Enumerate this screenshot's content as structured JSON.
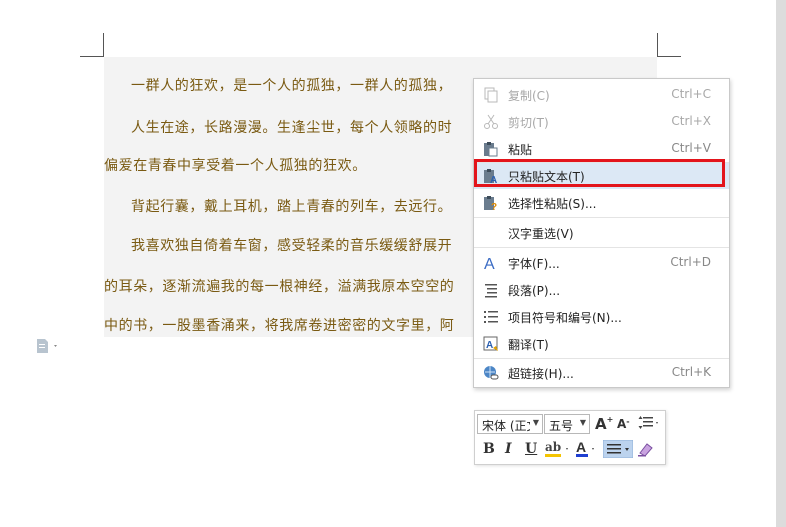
{
  "document": {
    "paragraphs": [
      "一群人的狂欢，是一个人的孤独，一群人的孤独，",
      "人生在途，长路漫漫。生逢尘世，每个人领略的时",
      "偏爱在青春中享受着一个人孤独的狂欢。",
      "背起行囊，戴上耳机，踏上青春的列车，去远行。",
      "我喜欢独自倚着车窗，感受轻柔的音乐缓缓舒展开",
      "的耳朵，逐渐流遍我的每一根神经，溢满我原本空空的",
      "中的书，一股墨香涌来，将我席卷进密密的文字里，阿"
    ]
  },
  "context_menu": {
    "items": [
      {
        "label": "复制(C)",
        "shortcut": "Ctrl+C",
        "icon": "copy-icon"
      },
      {
        "label": "剪切(T)",
        "shortcut": "Ctrl+X",
        "icon": "cut-icon"
      },
      {
        "label": "粘贴",
        "shortcut": "Ctrl+V",
        "icon": "paste-icon"
      },
      {
        "label": "只粘贴文本(T)",
        "shortcut": "",
        "icon": "paste-text-icon"
      },
      {
        "label": "选择性粘贴(S)...",
        "shortcut": "",
        "icon": "paste-special-icon"
      },
      {
        "label": "汉字重选(V)",
        "shortcut": "",
        "icon": ""
      },
      {
        "label": "字体(F)...",
        "shortcut": "Ctrl+D",
        "icon": "font-icon"
      },
      {
        "label": "段落(P)...",
        "shortcut": "",
        "icon": "paragraph-icon"
      },
      {
        "label": "项目符号和编号(N)...",
        "shortcut": "",
        "icon": "list-icon"
      },
      {
        "label": "翻译(T)",
        "shortcut": "",
        "icon": "translate-icon"
      },
      {
        "label": "超链接(H)...",
        "shortcut": "Ctrl+K",
        "icon": "hyperlink-icon"
      }
    ]
  },
  "mini_toolbar": {
    "font_name": "宋体 (正文)",
    "font_size": "五号",
    "font_color": "#1f3fd1",
    "highlight_color": "#f4c400"
  },
  "colors": {
    "highlight_box": "#e3141b",
    "document_text": "#7a5a12"
  }
}
